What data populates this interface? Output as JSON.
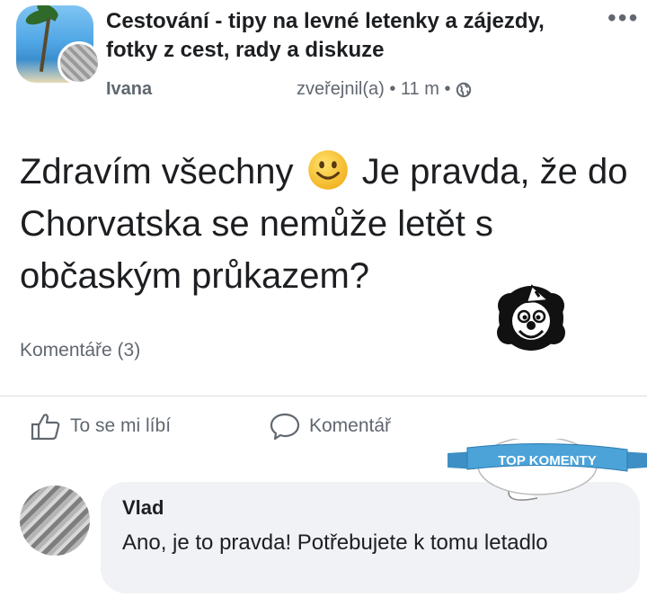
{
  "header": {
    "group_name": "Cestování - tipy na levné letenky a zájezdy, fotky z cest, rady a diskuze",
    "author": "Ivana",
    "meta": "zveřejnil(a) • 11 m •",
    "more": "•••"
  },
  "post": {
    "text_before": "Zdravím všechny",
    "text_after": "Je pravda, že do Chorvatska se nemůže letět s občaským průkazem?",
    "comments_count": "Komentáře (3)"
  },
  "actions": {
    "like_label": "To se mi líbí",
    "comment_label": "Komentář"
  },
  "banner": {
    "text": "TOP KOMENTY"
  },
  "comment": {
    "name": "Vlad",
    "text": "Ano, je to pravda! Potřebujete k tomu letadlo"
  },
  "colors": {
    "text": "#1c1e21",
    "muted": "#606770",
    "bubble": "#f0f2f5",
    "banner_blue": "#3d8fc4",
    "smiley_yellow": "#f7c531"
  },
  "icons": [
    "globe-icon",
    "thumbs-up-icon",
    "comment-icon",
    "smiley-emoji",
    "clown-sticker",
    "more-icon"
  ]
}
